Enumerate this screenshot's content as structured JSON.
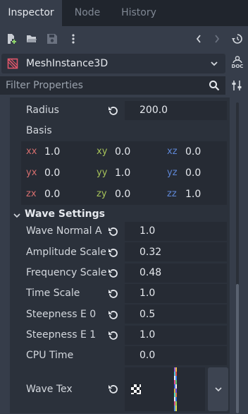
{
  "tabs": [
    {
      "label": "Inspector",
      "active": true
    },
    {
      "label": "Node",
      "active": false
    },
    {
      "label": "History",
      "active": false
    }
  ],
  "node_selector": {
    "name": "MeshInstance3D",
    "doc_label": "DOC"
  },
  "filter": {
    "placeholder": "Filter Properties"
  },
  "properties": {
    "radius": {
      "label": "Radius",
      "value": "200.0"
    },
    "basis": {
      "label": "Basis",
      "cells": [
        {
          "key": "xx",
          "value": "1.0"
        },
        {
          "key": "xy",
          "value": "0.0"
        },
        {
          "key": "xz",
          "value": "0.0"
        },
        {
          "key": "yx",
          "value": "0.0"
        },
        {
          "key": "yy",
          "value": "1.0"
        },
        {
          "key": "yz",
          "value": "0.0"
        },
        {
          "key": "zx",
          "value": "0.0"
        },
        {
          "key": "zy",
          "value": "0.0"
        },
        {
          "key": "zz",
          "value": "1.0"
        }
      ]
    }
  },
  "wave_settings": {
    "title": "Wave Settings",
    "rows": [
      {
        "label": "Wave Normal A",
        "value": "1.0"
      },
      {
        "label": "Amplitude Scale",
        "value": "0.32"
      },
      {
        "label": "Frequency Scale",
        "value": "0.48"
      },
      {
        "label": "Time Scale",
        "value": "1.0"
      },
      {
        "label": "Steepness E 0",
        "value": "0.5"
      },
      {
        "label": "Steepness E 1",
        "value": "1.0"
      },
      {
        "label": "CPU Time",
        "value": "0.0"
      },
      {
        "label": "Wave Tex",
        "value": ""
      }
    ]
  },
  "colors": {
    "x_axis": "#d56e6e",
    "y_axis": "#a7c35a",
    "z_axis": "#5e87d6",
    "accent": "#e0566a"
  }
}
